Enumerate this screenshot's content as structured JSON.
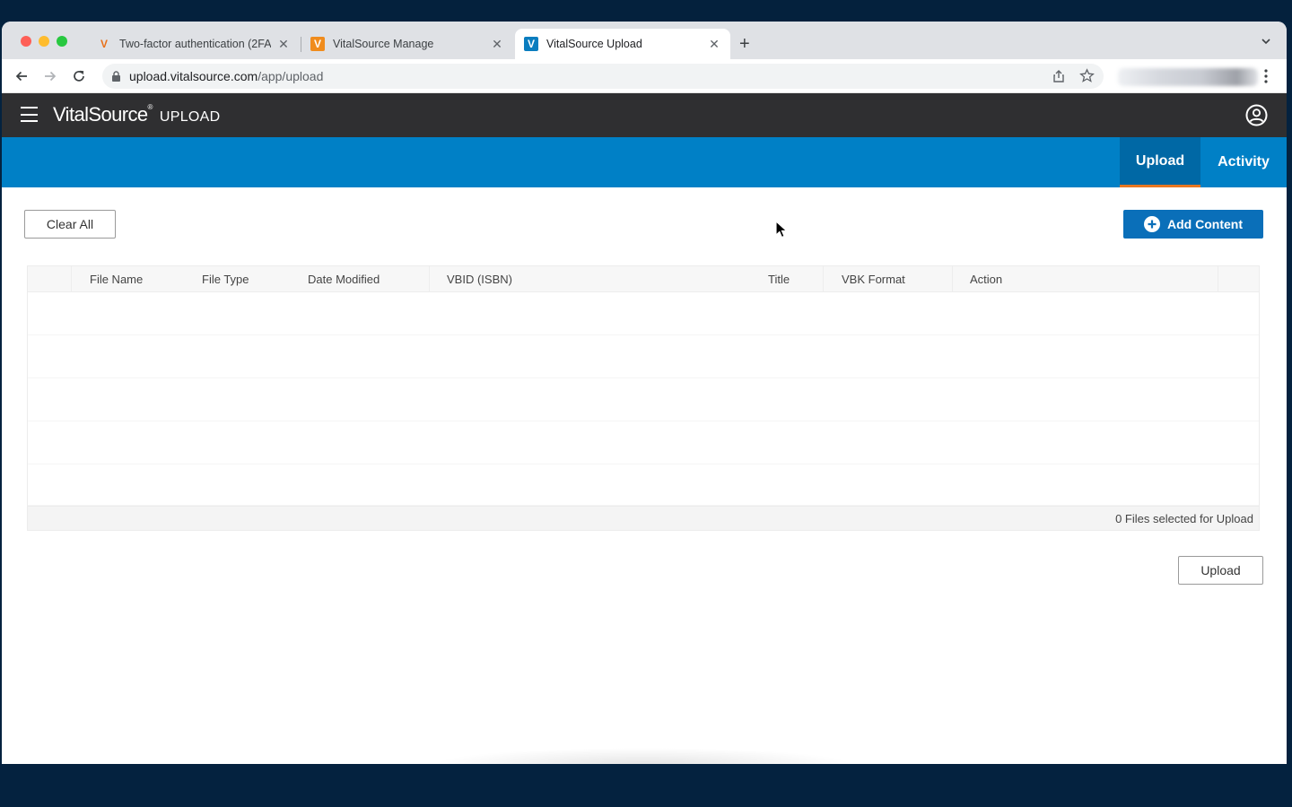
{
  "browser": {
    "tabs": [
      {
        "title": "Two-factor authentication (2FA",
        "favicon": "vitalsource-v-icon"
      },
      {
        "title": "VitalSource Manage",
        "favicon": "vitalsource-box-icon"
      },
      {
        "title": "VitalSource Upload",
        "favicon": "vitalsource-box-icon"
      }
    ],
    "active_tab": 2,
    "url_host": "upload.vitalsource.com",
    "url_path": "/app/upload"
  },
  "header": {
    "brand": "VitalSource",
    "brand_mark": "®",
    "product": "UPLOAD"
  },
  "nav": {
    "tabs": [
      {
        "label": "Upload"
      },
      {
        "label": "Activity"
      }
    ],
    "active": "Upload"
  },
  "toolbar": {
    "clear_all_label": "Clear All",
    "add_content_label": "Add Content"
  },
  "grid": {
    "columns": [
      "File Name",
      "File Type",
      "Date Modified",
      "VBID (ISBN)",
      "Title",
      "VBK Format",
      "Action"
    ],
    "rows": [],
    "footer_status": "0 Files selected for Upload"
  },
  "actions": {
    "upload_label": "Upload"
  },
  "colors": {
    "header_bg": "#2f2f31",
    "tabbar_bg": "#0080c6",
    "tab_active_bg": "#0068a5",
    "tab_indicator": "#e87722",
    "primary_button": "#0a6fb9"
  }
}
